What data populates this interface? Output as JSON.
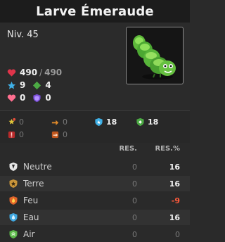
{
  "title": "Larve Émeraude",
  "level": "Niv. 45",
  "stats": {
    "hp": "490",
    "hp_max": "490",
    "ap": "9",
    "mp": "4",
    "heal": "0",
    "shield": "0"
  },
  "misc": [
    {
      "icon": "ap-reduction-icon",
      "value": "0"
    },
    {
      "icon": "mp-reduction-icon",
      "value": "0"
    },
    {
      "icon": "ap-dodge-icon",
      "value": "18"
    },
    {
      "icon": "mp-dodge-icon",
      "value": "18"
    },
    {
      "icon": "critical-resist-icon",
      "value": "0"
    },
    {
      "icon": "pushback-resist-icon",
      "value": "0"
    }
  ],
  "resistances": {
    "header_res": "RES.",
    "header_pct": "RES.%",
    "rows": [
      {
        "name": "Neutre",
        "res": "0",
        "pct": "16",
        "color": "#d9d9d9"
      },
      {
        "name": "Terre",
        "res": "0",
        "pct": "16",
        "color": "#c8943a"
      },
      {
        "name": "Feu",
        "res": "0",
        "pct": "-9",
        "color": "#e0642a"
      },
      {
        "name": "Eau",
        "res": "0",
        "pct": "16",
        "color": "#3fa7e0"
      },
      {
        "name": "Air",
        "res": "0",
        "pct": "0",
        "color": "#5cb84a"
      }
    ]
  },
  "colors": {
    "negative": "#ff5a3c",
    "hp": "#e0344a",
    "ap": "#3fb0e6",
    "mp": "#4caa44",
    "heal": "#ff6f8f",
    "shield": "#7b4fd8"
  }
}
